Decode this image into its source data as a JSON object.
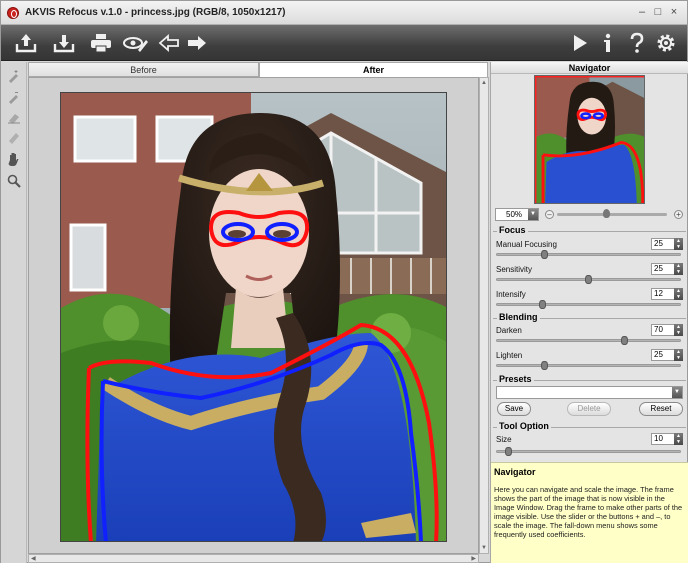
{
  "window": {
    "title": "AKVIS Refocus v.1.0 - princess.jpg (RGB/8, 1050x1217)",
    "controls": [
      "–",
      "□",
      "×"
    ]
  },
  "toolbar": {
    "left_icons": [
      "open-icon",
      "save-icon",
      "print-icon",
      "preferences-icon",
      "undo-icon",
      "redo-icon"
    ],
    "right_icons": [
      "run-icon",
      "info-icon",
      "help-icon",
      "settings-icon"
    ]
  },
  "tools": [
    "focus-area-icon",
    "background-area-icon",
    "eraser-icon",
    "magic-eraser-icon",
    "hand-icon",
    "zoom-icon"
  ],
  "tabs": {
    "before": "Before",
    "after": "After"
  },
  "navigator": {
    "title": "Navigator",
    "zoom": "50%",
    "zoom_fraction": 0.45
  },
  "focus": {
    "title": "Focus",
    "params": [
      {
        "label": "Manual Focusing",
        "value": "25",
        "fraction": 0.25
      },
      {
        "label": "Sensitivity",
        "value": "25",
        "fraction": 0.5
      },
      {
        "label": "Intensify",
        "value": "12",
        "fraction": 0.24
      }
    ]
  },
  "blending": {
    "title": "Blending",
    "params": [
      {
        "label": "Darken",
        "value": "70",
        "fraction": 0.7
      },
      {
        "label": "Lighten",
        "value": "25",
        "fraction": 0.25
      }
    ]
  },
  "presets": {
    "title": "Presets",
    "selected": "",
    "save": "Save",
    "delete": "Delete",
    "reset": "Reset"
  },
  "tool_option": {
    "title": "Tool Option",
    "size_label": "Size",
    "size_value": "10",
    "size_fraction": 0.05
  },
  "help": {
    "title": "Navigator",
    "text": "Here you can navigate and scale the image. The frame shows the part of the image that is now visible in the Image Window. Drag the frame to make other parts of the image visible. Use the slider or the buttons + and –, to scale the image. The fall-down menu shows some frequently used coefficients."
  },
  "colors": {
    "focus_stroke": "#ff1010",
    "background_stroke": "#1020ff",
    "help_bg": "#ffffc8",
    "toolbar_bg": "#3e3e3e"
  }
}
